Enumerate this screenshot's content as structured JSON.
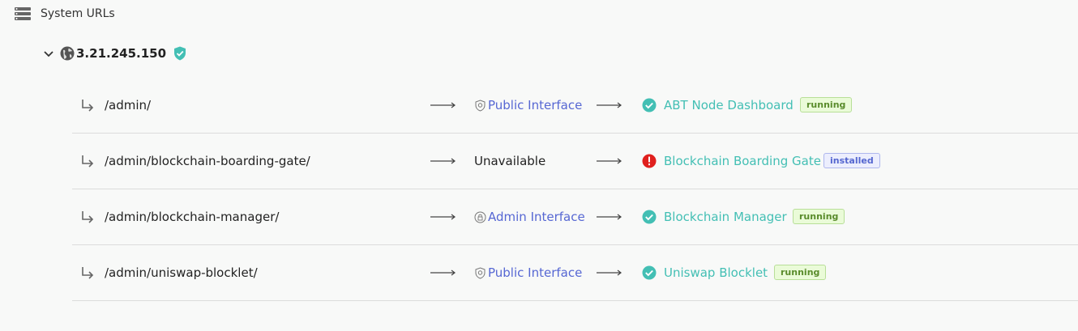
{
  "section": {
    "title": "System URLs",
    "icon": "server-list-icon"
  },
  "domain": {
    "host": "3.21.245.150",
    "expanded": true,
    "verified": true
  },
  "colors": {
    "link": "#5667d3",
    "app": "#43bfb4",
    "success": "#43bfb4",
    "error": "#e0201e"
  },
  "routes": [
    {
      "path": "/admin/",
      "interface": {
        "label": "Public Interface",
        "type": "public"
      },
      "status": "ok",
      "app": "ABT Node Dashboard",
      "badge": {
        "label": "running",
        "kind": "running"
      }
    },
    {
      "path": "/admin/blockchain-boarding-gate/",
      "interface": {
        "label": "Unavailable",
        "type": "none"
      },
      "status": "error",
      "app": "Blockchain Boarding Gate",
      "badge": {
        "label": "installed",
        "kind": "installed"
      }
    },
    {
      "path": "/admin/blockchain-manager/",
      "interface": {
        "label": "Admin Interface",
        "type": "admin"
      },
      "status": "ok",
      "app": "Blockchain Manager",
      "badge": {
        "label": "running",
        "kind": "running"
      }
    },
    {
      "path": "/admin/uniswap-blocklet/",
      "interface": {
        "label": "Public Interface",
        "type": "public"
      },
      "status": "ok",
      "app": "Uniswap Blocklet",
      "badge": {
        "label": "running",
        "kind": "running"
      }
    }
  ]
}
